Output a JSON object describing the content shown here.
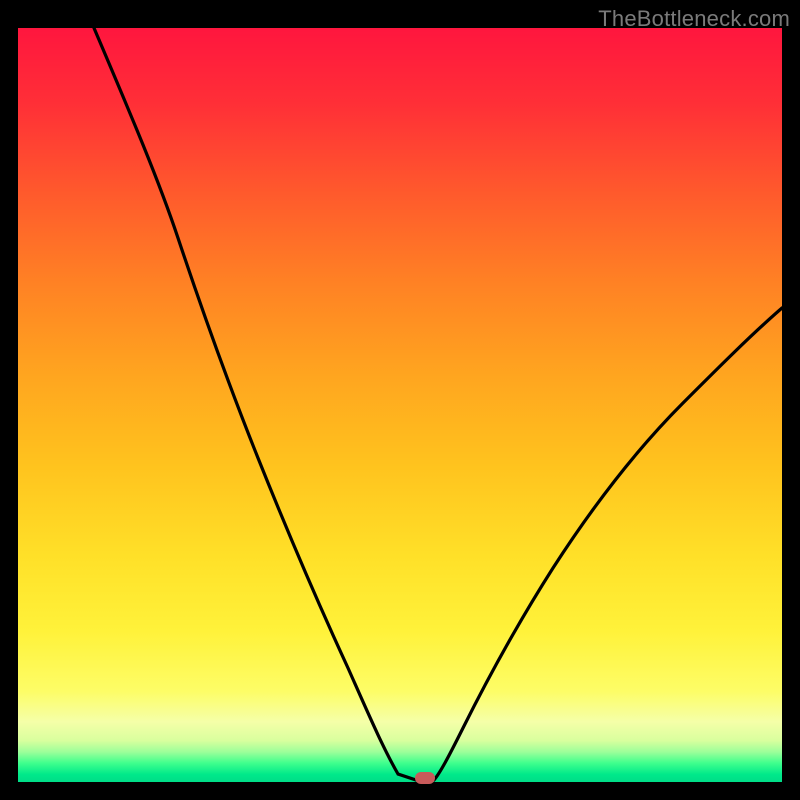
{
  "watermark": "TheBottleneck.com",
  "colors": {
    "background": "#000000",
    "gradient_top": "#ff163e",
    "gradient_bottom": "#00dd88",
    "curve": "#000000",
    "marker": "#c85a5a"
  },
  "chart_data": {
    "type": "line",
    "title": "",
    "xlabel": "",
    "ylabel": "",
    "xlim": [
      0,
      100
    ],
    "ylim": [
      0,
      100
    ],
    "grid": false,
    "legend": false,
    "x": [
      10,
      15,
      20,
      25,
      30,
      35,
      40,
      45,
      48,
      50,
      52,
      54,
      55,
      60,
      65,
      70,
      75,
      80,
      85,
      90,
      95,
      100
    ],
    "values": [
      100,
      90,
      80,
      69,
      59,
      48,
      36,
      22,
      10,
      2,
      0,
      0,
      2,
      12,
      22,
      31,
      38,
      45,
      51,
      56,
      61,
      65
    ],
    "marker": {
      "x": 53,
      "y": 0
    },
    "annotations": []
  }
}
